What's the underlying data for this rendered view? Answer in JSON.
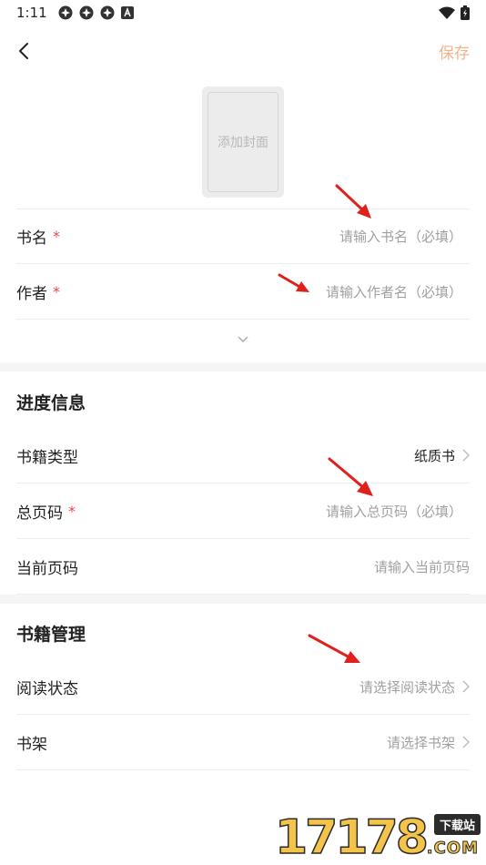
{
  "status_bar": {
    "time": "1:11",
    "notification_icons": [
      "app-icon",
      "app-icon",
      "app-icon",
      "a-icon"
    ],
    "right_icons": [
      "wifi-icon",
      "battery-charging-icon"
    ]
  },
  "nav": {
    "back_icon": "chevron-left-icon",
    "save_label": "保存",
    "save_color": "#f0b58a"
  },
  "cover": {
    "label": "添加封面"
  },
  "basic": {
    "title": {
      "label": "书名",
      "required": "*",
      "placeholder": "请输入书名（必填）"
    },
    "author": {
      "label": "作者",
      "required": "*",
      "placeholder": "请输入作者名（必填）"
    },
    "expand_icon": "chevron-down-icon"
  },
  "progress": {
    "title": "进度信息",
    "book_type": {
      "label": "书籍类型",
      "value": "纸质书"
    },
    "total_pages": {
      "label": "总页码",
      "required": "*",
      "placeholder": "请输入总页码（必填）"
    },
    "current_page": {
      "label": "当前页码",
      "placeholder": "请输入当前页码"
    }
  },
  "management": {
    "title": "书籍管理",
    "reading_status": {
      "label": "阅读状态",
      "placeholder": "请选择阅读状态"
    },
    "bookshelf": {
      "label": "书架",
      "placeholder": "请选择书架"
    }
  },
  "watermark": {
    "number": "17178",
    "badge": "下载站",
    "domain": ".COM"
  },
  "colors": {
    "required": "#e5484d",
    "placeholder": "#a0a0a0",
    "annotation_arrow": "#e0201b",
    "divider": "#eeeeee",
    "section_gap": "#f5f5f5"
  }
}
